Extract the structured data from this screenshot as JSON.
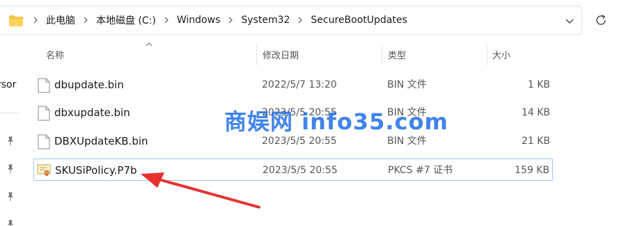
{
  "address_bar": {
    "breadcrumbs": [
      "此电脑",
      "本地磁盘 (C:)",
      "Windows",
      "System32",
      "SecureBootUpdates"
    ]
  },
  "left_pane": {
    "partial_label": "rsor"
  },
  "columns": {
    "name": "名称",
    "date": "修改日期",
    "type": "类型",
    "size": "大小"
  },
  "files": [
    {
      "name": "dbupdate.bin",
      "date": "2022/5/7 13:20",
      "type": "BIN 文件",
      "size": "1 KB"
    },
    {
      "name": "dbxupdate.bin",
      "date": "2023/5/5 20:55",
      "type": "BIN 文件",
      "size": "14 KB"
    },
    {
      "name": "DBXUpdateKB.bin",
      "date": "2023/5/5 20:55",
      "type": "BIN 文件",
      "size": "21 KB"
    },
    {
      "name": "SKUSiPolicy.P7b",
      "date": "2023/5/5 20:55",
      "type": "PKCS #7 证书",
      "size": "159 KB"
    }
  ],
  "watermark": "商娱网 info35.com",
  "colors": {
    "accent_arrow": "#e8322f",
    "selection_border": "#9fc4ec",
    "folder": "#f5c443",
    "watermark": "#1e6ee6"
  },
  "icons": [
    "folder-icon",
    "chevron-right-icon",
    "chevron-down-icon",
    "refresh-icon",
    "pin-icon",
    "file-icon",
    "certificate-icon",
    "sort-up-icon"
  ]
}
